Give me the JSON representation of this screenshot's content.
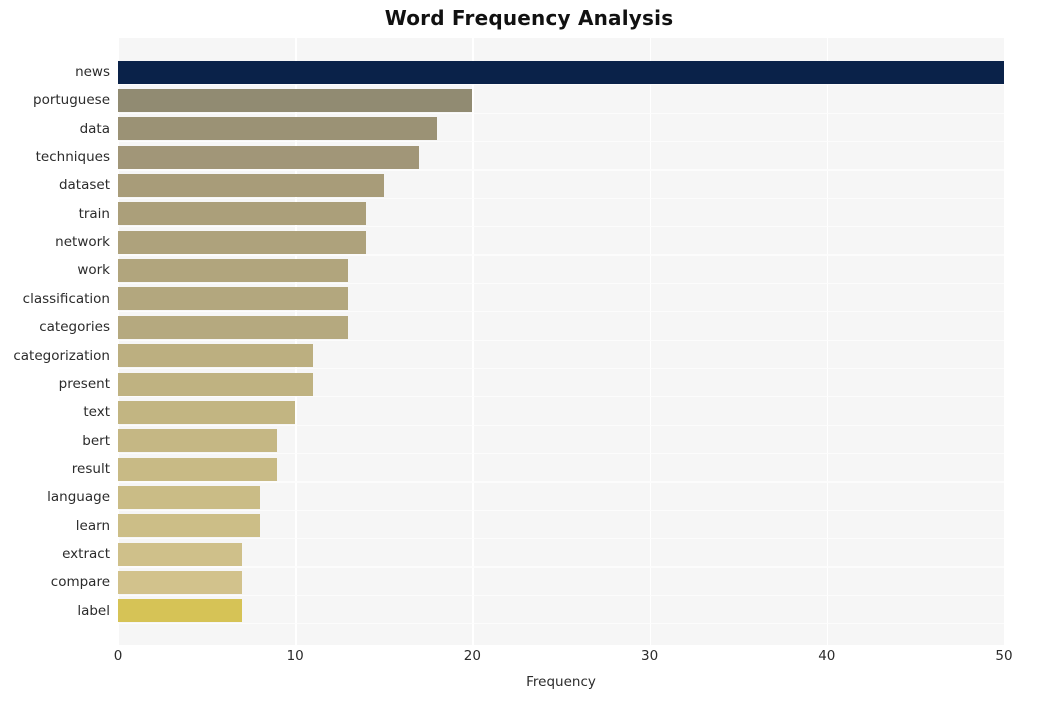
{
  "chart_data": {
    "type": "bar",
    "orientation": "horizontal",
    "title": "Word Frequency Analysis",
    "xlabel": "Frequency",
    "ylabel": "",
    "categories": [
      "news",
      "portuguese",
      "data",
      "techniques",
      "dataset",
      "train",
      "network",
      "work",
      "classification",
      "categories",
      "categorization",
      "present",
      "text",
      "bert",
      "result",
      "language",
      "learn",
      "extract",
      "compare",
      "label"
    ],
    "values": [
      50,
      20,
      18,
      17,
      15,
      14,
      14,
      13,
      13,
      13,
      11,
      11,
      10,
      9,
      9,
      8,
      8,
      7,
      7,
      7
    ],
    "bar_colors": [
      "#0a2249",
      "#918b72",
      "#9b9275",
      "#a19678",
      "#a89c79",
      "#ab9f7a",
      "#aea27c",
      "#b1a57d",
      "#b3a77e",
      "#b5a97f",
      "#bcaf80",
      "#bfb281",
      "#c2b582",
      "#c5b784",
      "#c8ba85",
      "#cabc86",
      "#ccbe87",
      "#cfc08a",
      "#d2c28c",
      "#d6c356"
    ],
    "xlim": [
      0,
      50
    ],
    "ylim_categories": 20,
    "xticks": [
      0,
      10,
      20,
      30,
      40,
      50
    ],
    "xtick_labels": [
      "0",
      "10",
      "20",
      "30",
      "40",
      "50"
    ],
    "grid": true,
    "grid_axis": "x",
    "grid_color": "#ffffff",
    "legend": null,
    "plot_background": "#f6f6f6",
    "figure_background": "#ffffff",
    "title_color": "#111111",
    "tick_label_color": "#2b2b2b"
  }
}
